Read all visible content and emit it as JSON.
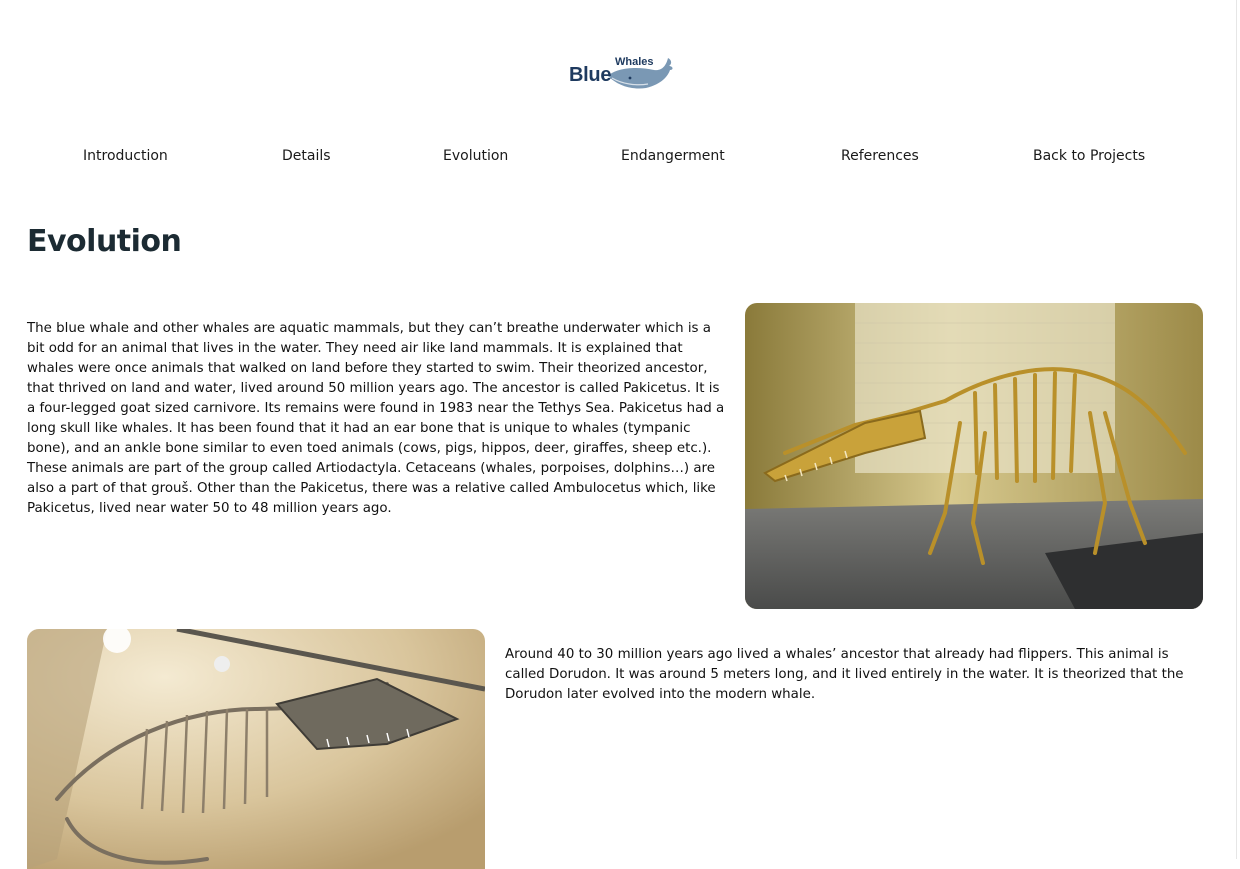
{
  "logo": {
    "word_blue": "Blue",
    "word_whales": "Whales",
    "primary_color": "#1e3a5f",
    "whale_color": "#7a98b4"
  },
  "nav": {
    "items": [
      {
        "label": "Introduction"
      },
      {
        "label": "Details"
      },
      {
        "label": "Evolution"
      },
      {
        "label": "Endangerment"
      },
      {
        "label": "References"
      },
      {
        "label": "Back to Projects"
      }
    ]
  },
  "main": {
    "title": "Evolution",
    "paragraph_1": "The blue whale and other whales are aquatic mammals, but they can’t breathe underwater which is a bit odd for an animal that lives in the water. They need air like land mammals. It is explained that whales were once animals that walked on land before they started to swim. Their theorized ancestor, that thrived on land and water, lived around 50 million years ago. The ancestor is called Pakicetus. It is a four-legged goat sized carnivore. Its remains were found in 1983 near the Tethys Sea. Pakicetus had a long skull like whales. It has been found that it had an ear bone that is unique to whales (tympanic bone), and an ankle bone similar to even toed animals (cows, pigs, hippos, deer, giraffes, sheep etc.). These animals are part of the group called Artiodactyla. Cetaceans (whales, porpoises, dolphins…) are also a part of that grouš. Other than the Pakicetus, there was a relative called Ambulocetus which, like Pakicetus, lived near water 50 to 48 million years ago.",
    "paragraph_2": "Around 40 to 30 million years ago lived a whales’ ancestor that already had flippers. This animal is called Dorudon. It was around 5 meters long, and it lived entirely in the water. It is theorized that the Dorudon later evolved into the modern whale."
  }
}
